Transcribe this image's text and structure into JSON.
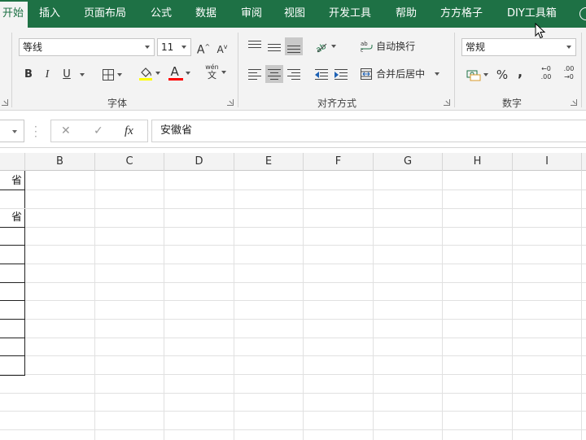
{
  "tabs": [
    {
      "label": "开始",
      "active": true
    },
    {
      "label": "插入"
    },
    {
      "label": "页面布局"
    },
    {
      "label": "公式"
    },
    {
      "label": "数据"
    },
    {
      "label": "审阅"
    },
    {
      "label": "视图"
    },
    {
      "label": "开发工具"
    },
    {
      "label": "帮助"
    },
    {
      "label": "方方格子"
    },
    {
      "label": "DIY工具箱"
    }
  ],
  "ribbon": {
    "font": {
      "name": "等线",
      "size": "11",
      "grow_label": "A",
      "shrink_label": "A",
      "bold": "B",
      "italic": "I",
      "underline": "U",
      "font_color_label": "A",
      "phonetic_top": "wén",
      "phonetic_bottom": "文",
      "group_label": "字体"
    },
    "alignment": {
      "wrap_label": "自动换行",
      "merge_label": "合并后居中",
      "group_label": "对齐方式"
    },
    "number": {
      "format": "常规",
      "percent": "%",
      "comma": ",",
      "inc_decimal_top": "←0",
      "inc_decimal_bottom": ".00",
      "dec_decimal_top": ".00",
      "dec_decimal_bottom": "→0",
      "group_label": "数字"
    }
  },
  "formula_bar": {
    "cancel": "✕",
    "enter": "✓",
    "fx": "fx",
    "value": "安徽省"
  },
  "grid": {
    "columns": [
      "B",
      "C",
      "D",
      "E",
      "F",
      "G",
      "H",
      "I"
    ],
    "column_a_cells": [
      "省",
      "",
      "省",
      "",
      "",
      "",
      "",
      "",
      "",
      ""
    ]
  },
  "colors": {
    "tab_bar": "#1e7145",
    "highlight_fill": "#ffff00",
    "font_color": "#ff0000"
  }
}
